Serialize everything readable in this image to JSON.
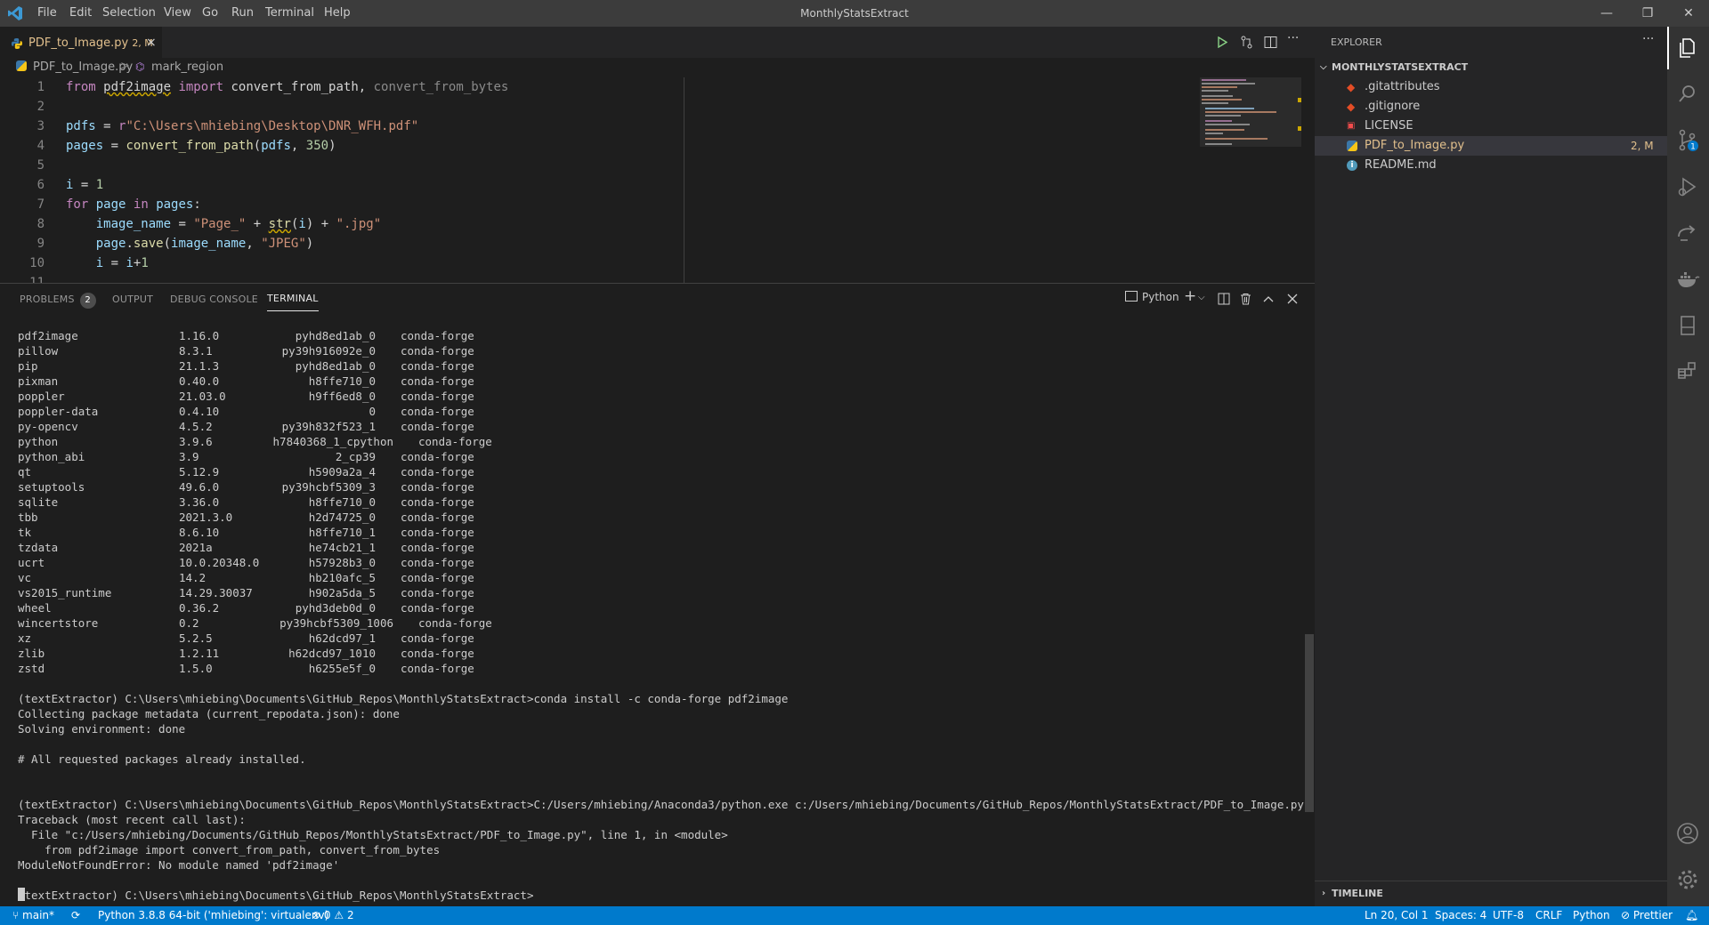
{
  "titlebar": {
    "menus": [
      "File",
      "Edit",
      "Selection",
      "View",
      "Go",
      "Run",
      "Terminal",
      "Help"
    ],
    "title": "MonthlyStatsExtract",
    "minimize": "—",
    "restore": "❐",
    "close": "✕"
  },
  "tab": {
    "label": "PDF_to_Image.py",
    "badge": "2, M",
    "close": "×"
  },
  "breadcrumb": {
    "file": "PDF_to_Image.py",
    "sep": ">",
    "symbol": "mark_region"
  },
  "editor": {
    "line_numbers": [
      "1",
      "2",
      "3",
      "4",
      "5",
      "6",
      "7",
      "8",
      "9",
      "10",
      "11"
    ]
  },
  "panel": {
    "tabs": {
      "problems": "PROBLEMS",
      "problems_count": "2",
      "output": "OUTPUT",
      "debug": "DEBUG CONSOLE",
      "terminal": "TERMINAL"
    },
    "shell": "Python"
  },
  "terminal": {
    "packages": [
      [
        "pdf2image",
        "1.16.0",
        "pyhd8ed1ab_0",
        "conda-forge"
      ],
      [
        "pillow",
        "8.3.1",
        "py39h916092e_0",
        "conda-forge"
      ],
      [
        "pip",
        "21.1.3",
        "pyhd8ed1ab_0",
        "conda-forge"
      ],
      [
        "pixman",
        "0.40.0",
        "h8ffe710_0",
        "conda-forge"
      ],
      [
        "poppler",
        "21.03.0",
        "h9ff6ed8_0",
        "conda-forge"
      ],
      [
        "poppler-data",
        "0.4.10",
        "0",
        "conda-forge"
      ],
      [
        "py-opencv",
        "4.5.2",
        "py39h832f523_1",
        "conda-forge"
      ],
      [
        "python",
        "3.9.6",
        "h7840368_1_cpython",
        "conda-forge"
      ],
      [
        "python_abi",
        "3.9",
        "2_cp39",
        "conda-forge"
      ],
      [
        "qt",
        "5.12.9",
        "h5909a2a_4",
        "conda-forge"
      ],
      [
        "setuptools",
        "49.6.0",
        "py39hcbf5309_3",
        "conda-forge"
      ],
      [
        "sqlite",
        "3.36.0",
        "h8ffe710_0",
        "conda-forge"
      ],
      [
        "tbb",
        "2021.3.0",
        "h2d74725_0",
        "conda-forge"
      ],
      [
        "tk",
        "8.6.10",
        "h8ffe710_1",
        "conda-forge"
      ],
      [
        "tzdata",
        "2021a",
        "he74cb21_1",
        "conda-forge"
      ],
      [
        "ucrt",
        "10.0.20348.0",
        "h57928b3_0",
        "conda-forge"
      ],
      [
        "vc",
        "14.2",
        "hb210afc_5",
        "conda-forge"
      ],
      [
        "vs2015_runtime",
        "14.29.30037",
        "h902a5da_5",
        "conda-forge"
      ],
      [
        "wheel",
        "0.36.2",
        "pyhd3deb0d_0",
        "conda-forge"
      ],
      [
        "wincertstore",
        "0.2",
        "py39hcbf5309_1006",
        "conda-forge"
      ],
      [
        "xz",
        "5.2.5",
        "h62dcd97_1",
        "conda-forge"
      ],
      [
        "zlib",
        "1.2.11",
        "h62dcd97_1010",
        "conda-forge"
      ],
      [
        "zstd",
        "1.5.0",
        "h6255e5f_0",
        "conda-forge"
      ]
    ],
    "lines": [
      "",
      "(textExtractor) C:\\Users\\mhiebing\\Documents\\GitHub_Repos\\MonthlyStatsExtract>conda install -c conda-forge pdf2image",
      "Collecting package metadata (current_repodata.json): done",
      "Solving environment: done",
      "",
      "# All requested packages already installed.",
      "",
      "",
      "(textExtractor) C:\\Users\\mhiebing\\Documents\\GitHub_Repos\\MonthlyStatsExtract>C:/Users/mhiebing/Anaconda3/python.exe c:/Users/mhiebing/Documents/GitHub_Repos/MonthlyStatsExtract/PDF_to_Image.py",
      "Traceback (most recent call last):",
      "  File \"c:/Users/mhiebing/Documents/GitHub_Repos/MonthlyStatsExtract/PDF_to_Image.py\", line 1, in <module>",
      "    from pdf2image import convert_from_path, convert_from_bytes",
      "ModuleNotFoundError: No module named 'pdf2image'",
      ""
    ],
    "prompt": "(textExtractor) C:\\Users\\mhiebing\\Documents\\GitHub_Repos\\MonthlyStatsExtract>"
  },
  "explorer": {
    "header": "EXPLORER",
    "more": "···",
    "folder": "MONTHLYSTATSEXTRACT",
    "files": [
      {
        "name": ".gitattributes",
        "icon": "git-icon",
        "badge": ""
      },
      {
        "name": ".gitignore",
        "icon": "git-icon",
        "badge": ""
      },
      {
        "name": "LICENSE",
        "icon": "license-icon",
        "badge": ""
      },
      {
        "name": "PDF_to_Image.py",
        "icon": "python-icon",
        "badge": "2, M"
      },
      {
        "name": "README.md",
        "icon": "info-icon",
        "badge": ""
      }
    ],
    "timeline": "TIMELINE"
  },
  "statusbar": {
    "branch": "main*",
    "interpreter": "Python 3.8.8 64-bit ('mhiebing': virtualenv)",
    "errors": "0",
    "warnings": "2",
    "position": "Ln 20, Col 1",
    "spaces": "Spaces: 4",
    "encoding": "UTF-8",
    "eol": "CRLF",
    "language": "Python",
    "formatter": "Prettier"
  },
  "colors": {
    "accent": "#007acc",
    "modified": "#e2c08d",
    "titlebar": "#3c3c3c",
    "sidebar": "#252526",
    "activitybar": "#333333"
  }
}
